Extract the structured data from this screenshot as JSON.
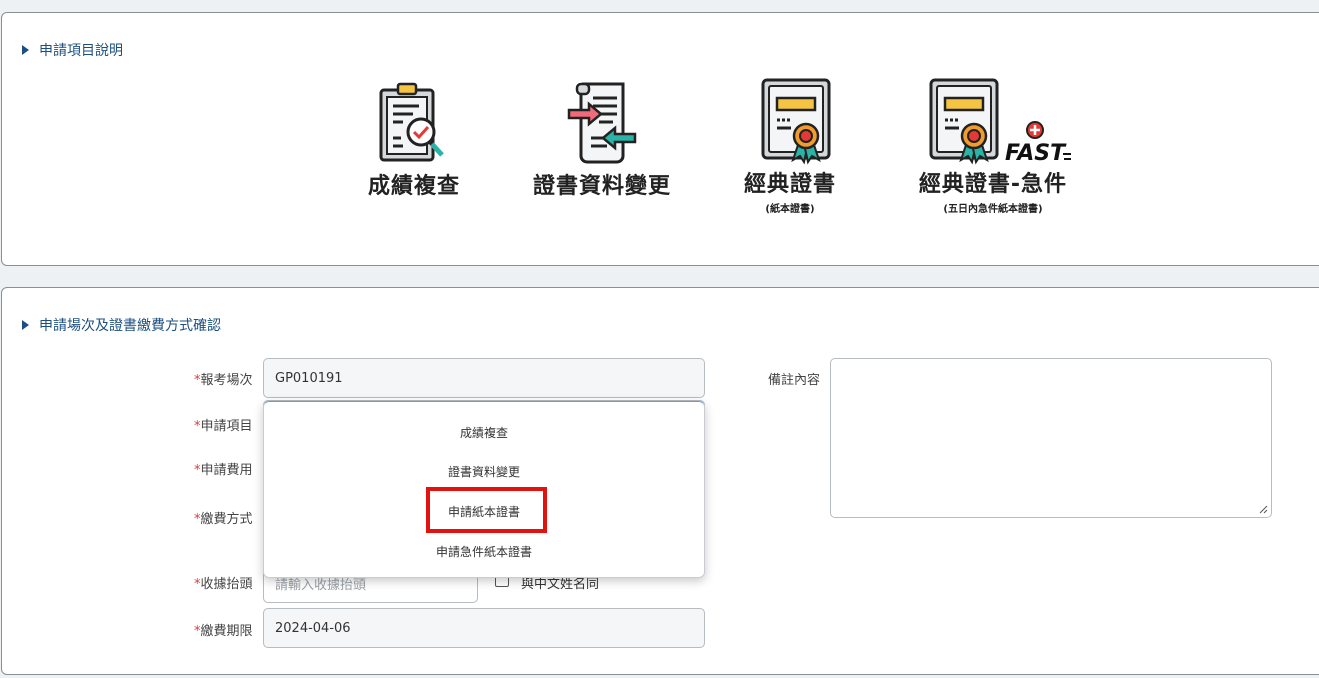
{
  "section1": {
    "title": "申請項目說明",
    "services": [
      {
        "label": "成績複查",
        "sub": "",
        "icon": "clipboard-search-icon"
      },
      {
        "label": "證書資料變更",
        "sub": "",
        "icon": "document-exchange-icon"
      },
      {
        "label": "經典證書",
        "sub": "(紙本證書)",
        "icon": "certificate-icon"
      },
      {
        "label": "經典證書-急件",
        "sub": "(五日內急件紙本證書)",
        "icon": "certificate-fast-icon",
        "badge_text": "FAST"
      }
    ]
  },
  "section2": {
    "title": "申請場次及證書繳費方式確認",
    "fields": {
      "exam_session": {
        "label": "報考場次",
        "value": "GP010191"
      },
      "apply_item": {
        "label": "申請項目"
      },
      "apply_fee": {
        "label": "申請費用"
      },
      "payment_method": {
        "label": "繳費方式"
      },
      "receipt_title": {
        "label": "收據抬頭",
        "placeholder": "請輸入收據抬頭"
      },
      "same_as_chinese_name": {
        "label": "與中文姓名同"
      },
      "payment_deadline": {
        "label": "繳費期限",
        "value": "2024-04-06"
      },
      "remarks": {
        "label": "備註內容"
      }
    },
    "required_mark": "*",
    "dropdown_options": [
      "成績複查",
      "證書資料變更",
      "申請紙本證書",
      "申請急件紙本證書"
    ],
    "highlighted_option": "申請紙本證書"
  },
  "colors": {
    "accent": "#1c4f80",
    "required": "#e0383b",
    "highlight": "#e3120e",
    "icon_red": "#e53935",
    "icon_orange": "#f39c2e",
    "icon_yellow": "#f5c542",
    "icon_teal": "#2ab3a6",
    "icon_pink": "#ef6b7b"
  }
}
